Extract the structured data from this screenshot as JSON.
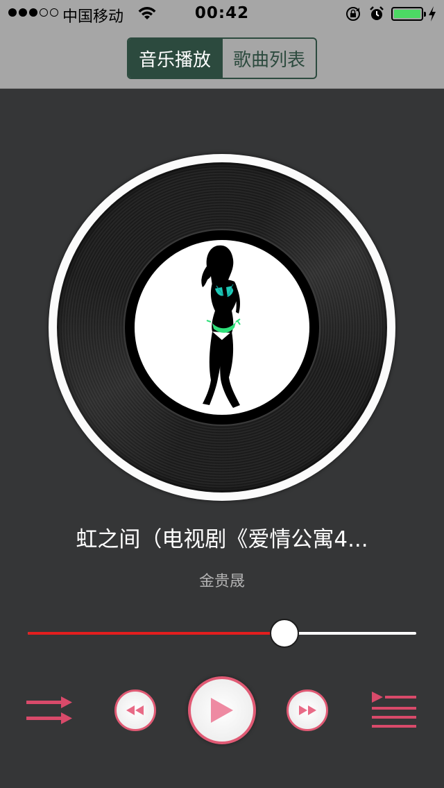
{
  "status_bar": {
    "carrier": "中国移动",
    "time": "00:42",
    "signal_bars_filled": 3,
    "signal_bars_total": 5,
    "battery_level": 1.0
  },
  "nav": {
    "tabs": [
      {
        "label": "音乐播放",
        "active": true
      },
      {
        "label": "歌曲列表",
        "active": false
      }
    ]
  },
  "song": {
    "title": "虹之间（电视剧《爱情公寓4...",
    "artist": "金贵晟"
  },
  "progress": {
    "fraction": 0.661
  },
  "colors": {
    "accent": "#e05a74",
    "progress_fill": "#e41e1e",
    "nav_active": "#2c4a3e",
    "background": "#353637"
  },
  "icons": {
    "shuffle": "shuffle-icon",
    "previous": "rewind-icon",
    "play": "play-icon",
    "next": "fast-forward-icon",
    "playlist": "playlist-icon"
  }
}
